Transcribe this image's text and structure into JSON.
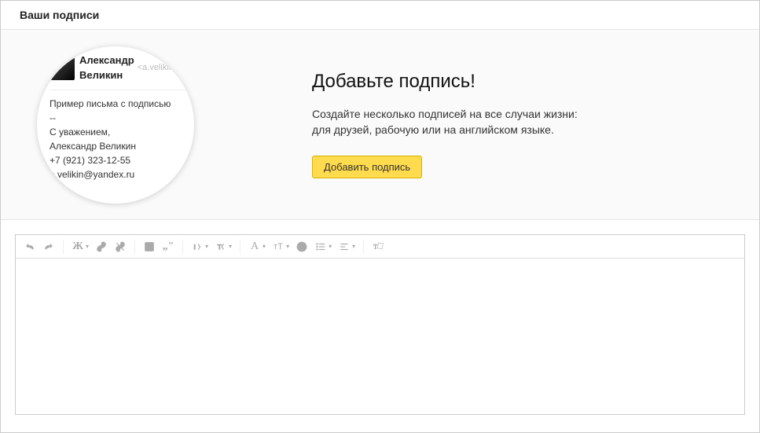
{
  "header": {
    "title": "Ваши подписи"
  },
  "preview": {
    "name": "Александр Великин",
    "email": "<a.velikin@yandex.ru>",
    "sample_label": "Пример письма с подписью",
    "sep": "--",
    "regards": "С уважением,",
    "sig_name": "Александр Великин",
    "phone": "+7 (921) 323-12-55",
    "sig_email": "a.velikin@yandex.ru"
  },
  "hero": {
    "title": "Добавьте подпись!",
    "desc_line1": "Создайте несколько подписей на все случаи жизни:",
    "desc_line2": "для друзей, рабочую или на английском языке.",
    "button": "Добавить подпись"
  },
  "toolbar": {
    "icons": {
      "undo": "↶",
      "redo": "↷",
      "bold": "Ж",
      "link": "🔗",
      "unlink": "⎘",
      "image": "▣",
      "quote": "❝❞",
      "indent_up": "I",
      "indent_down": "T",
      "font_face": "A",
      "font_size": "тT",
      "emoji": "☺",
      "list": "≡",
      "align": "≡",
      "clear": "T"
    }
  }
}
